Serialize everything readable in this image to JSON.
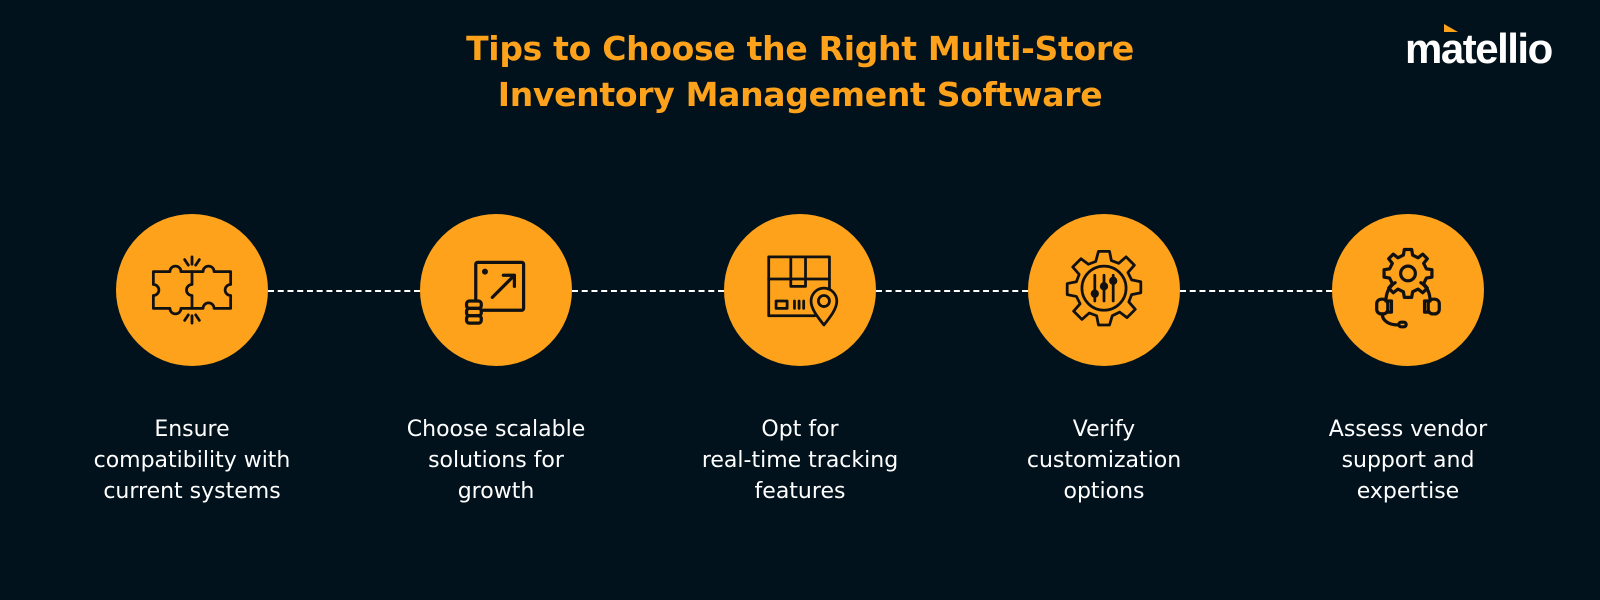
{
  "header": {
    "title_line1": "Tips to Choose the Right Multi-Store",
    "title_line2": "Inventory Management Software"
  },
  "brand": {
    "logo_text_prefix": "m",
    "logo_text_accent": "a",
    "logo_text_suffix": "tellio",
    "colors": {
      "background": "#02121d",
      "accent": "#fda21a",
      "text": "#ffffff",
      "icon_stroke": "#111111"
    }
  },
  "steps": [
    {
      "icon": "puzzle-icon",
      "label": "Ensure\ncompatibility with\ncurrent systems"
    },
    {
      "icon": "scale-up-icon",
      "label": "Choose scalable\nsolutions for\ngrowth"
    },
    {
      "icon": "package-tracking-icon",
      "label": "Opt for\nreal-time tracking\nfeatures"
    },
    {
      "icon": "gear-settings-icon",
      "label": "Verify\ncustomization\noptions"
    },
    {
      "icon": "support-gear-icon",
      "label": "Assess vendor\nsupport and\nexpertise"
    }
  ]
}
